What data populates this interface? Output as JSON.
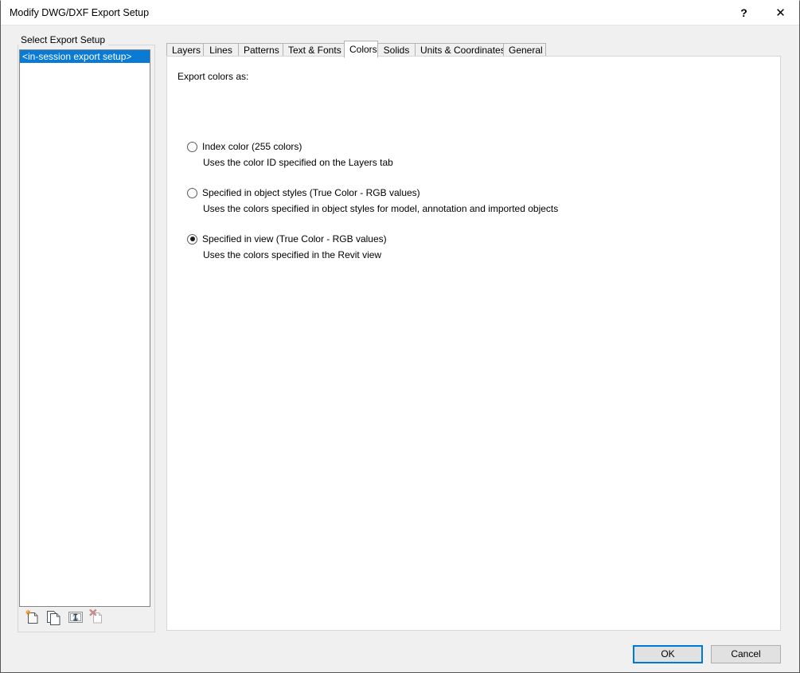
{
  "window": {
    "title": "Modify DWG/DXF Export Setup",
    "help_icon": "?",
    "close_icon": "✕"
  },
  "left_panel": {
    "group_label": "Select Export Setup",
    "list_items": [
      {
        "label": "<in-session export setup>",
        "selected": true
      }
    ],
    "toolbar": [
      {
        "name": "new-export-setup-icon",
        "tooltip": "New"
      },
      {
        "name": "duplicate-export-setup-icon",
        "tooltip": "Duplicate"
      },
      {
        "name": "rename-export-setup-icon",
        "tooltip": "Rename"
      },
      {
        "name": "delete-export-setup-icon",
        "tooltip": "Delete"
      }
    ]
  },
  "tabs": [
    {
      "label": "Layers",
      "active": false
    },
    {
      "label": "Lines",
      "active": false
    },
    {
      "label": "Patterns",
      "active": false
    },
    {
      "label": "Text & Fonts",
      "active": false
    },
    {
      "label": "Colors",
      "active": true
    },
    {
      "label": "Solids",
      "active": false
    },
    {
      "label": "Units & Coordinates",
      "active": false
    },
    {
      "label": "General",
      "active": false
    }
  ],
  "colors_tab": {
    "section_label": "Export colors as:",
    "options": [
      {
        "label": "Index color (255 colors)",
        "description": "Uses the color ID specified on the Layers tab",
        "selected": false
      },
      {
        "label": "Specified in object styles (True Color - RGB values)",
        "description": "Uses the colors specified in object styles for model, annotation and imported objects",
        "selected": false
      },
      {
        "label": "Specified in view (True Color - RGB values)",
        "description": "Uses the colors specified in the Revit view",
        "selected": true
      }
    ]
  },
  "footer": {
    "ok_label": "OK",
    "cancel_label": "Cancel"
  },
  "colors": {
    "selection_blue": "#0a7bd4",
    "focus_blue": "#0078d7",
    "dialog_bg": "#f0f0f0",
    "panel_bg": "#ffffff"
  }
}
